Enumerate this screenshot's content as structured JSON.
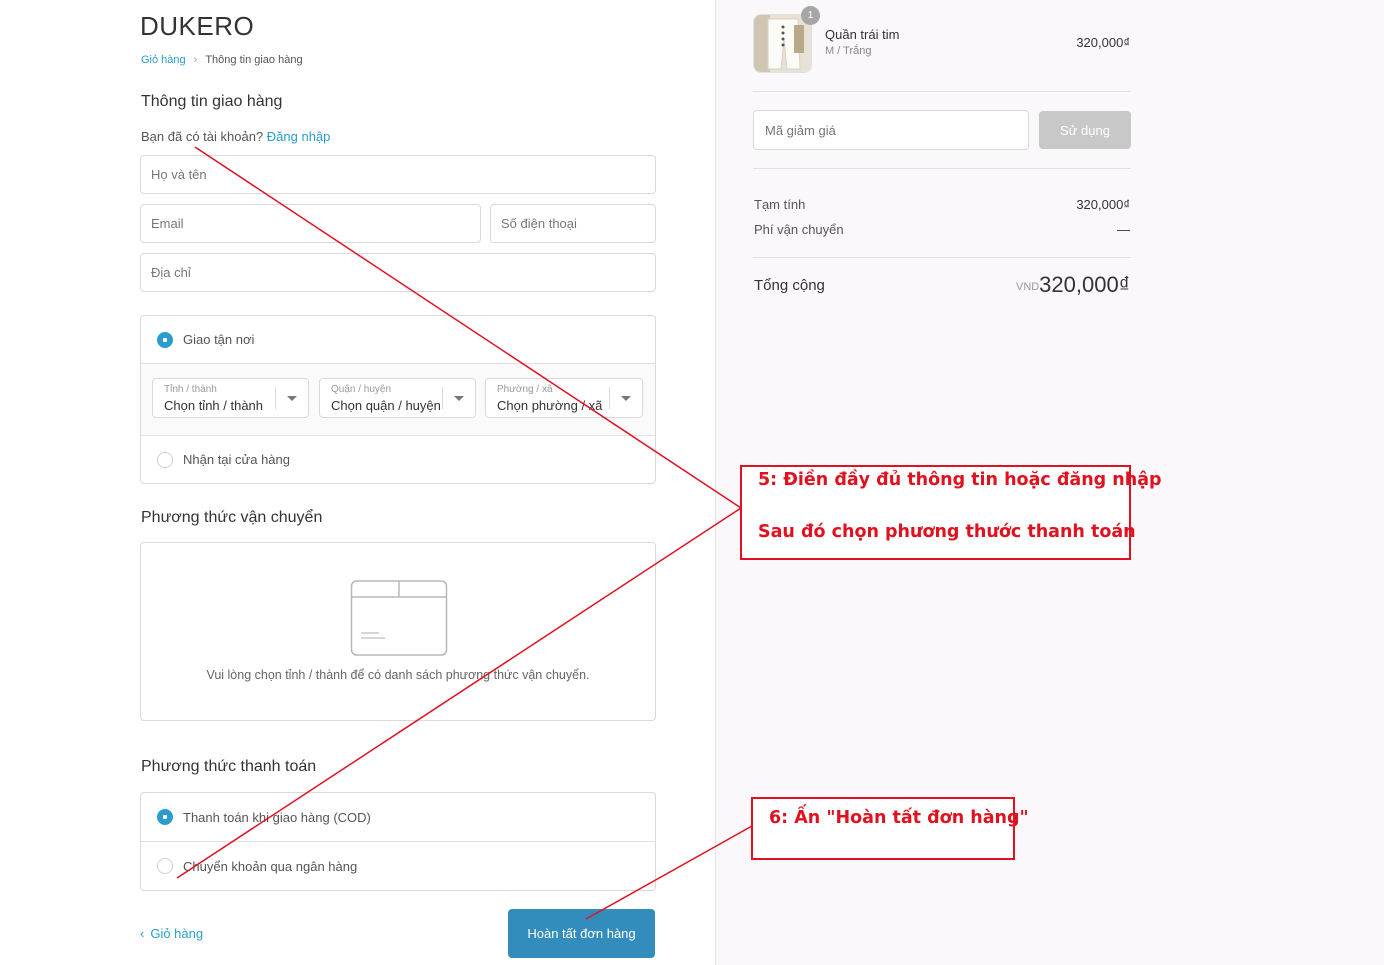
{
  "store": {
    "name": "DUKERO"
  },
  "breadcrumb": {
    "cart": "Giỏ hàng",
    "current": "Thông tin giao hàng"
  },
  "shipping_info": {
    "title": "Thông tin giao hàng",
    "account_prompt": "Bạn đã có tài khoản?",
    "login_link": "Đăng nhập",
    "name_placeholder": "Họ và tên",
    "email_placeholder": "Email",
    "phone_placeholder": "Số điện thoại",
    "address_placeholder": "Địa chỉ"
  },
  "delivery_options": {
    "home_delivery": "Giao tận nơi",
    "store_pickup": "Nhận tại cửa hàng",
    "province": {
      "label": "Tỉnh / thành",
      "value": "Chọn tỉnh / thành"
    },
    "district": {
      "label": "Quận / huyện",
      "value": "Chọn quận / huyện"
    },
    "ward": {
      "label": "Phường / xã",
      "value": "Chọn phường / xã"
    }
  },
  "shipping_method": {
    "title": "Phương thức vận chuyển",
    "empty_message": "Vui lòng chọn tỉnh / thành để có danh sách phương thức vận chuyển."
  },
  "payment_method": {
    "title": "Phương thức thanh toán",
    "cod": "Thanh toán khi giao hàng (COD)",
    "bank_transfer": "Chuyển khoản qua ngân hàng"
  },
  "footer": {
    "back_label": "Giỏ hàng",
    "complete_label": "Hoàn tất đơn hàng"
  },
  "order_summary": {
    "product": {
      "name": "Quần trái tim",
      "variant": "M / Trắng",
      "quantity": "1",
      "price": "320,000₫"
    },
    "discount_placeholder": "Mã giảm giá",
    "apply_label": "Sử dụng",
    "subtotal_label": "Tạm tính",
    "subtotal_value": "320,000₫",
    "shipping_label": "Phí vận chuyển",
    "shipping_value": "—",
    "total_label": "Tổng cộng",
    "currency": "VND",
    "total_value": "320,000₫"
  },
  "annotations": {
    "step5_line1": "5: Điền đầy đủ thông tin hoặc đăng nhập",
    "step5_line2": "Sau đó chọn phương thước thanh toán",
    "step6": "6: Ấn \"Hoàn tất đơn hàng\""
  },
  "colors": {
    "accent": "#338dbc",
    "link": "#2a9dcc",
    "annotation": "#e0121f",
    "sidebar_bg": "#fbf8fb"
  }
}
